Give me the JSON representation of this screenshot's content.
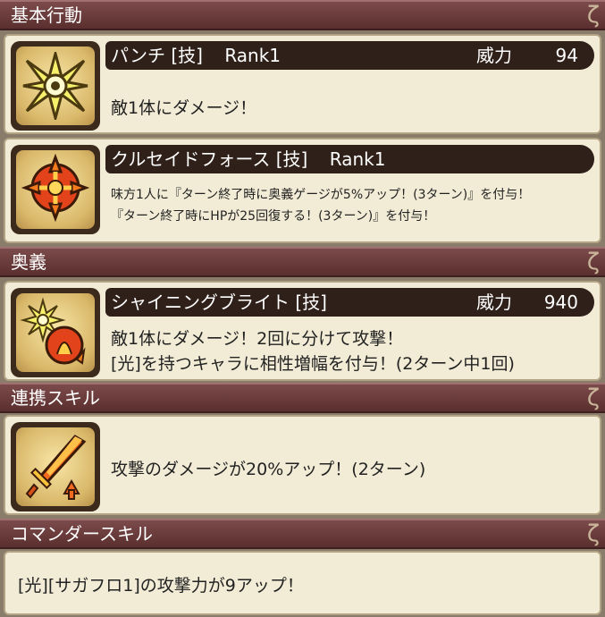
{
  "sections": {
    "basic": "基本行動",
    "ougi": "奥義",
    "link": "連携スキル",
    "commander": "コマンダースキル"
  },
  "curl_glyph": "ζ",
  "skills": {
    "punch": {
      "name": "パンチ [技]",
      "rank": "Rank1",
      "power_label": "威力",
      "power": "94",
      "desc": "敵1体にダメージ！",
      "icon": "star-burst-icon"
    },
    "crusade": {
      "name": "クルセイドフォース [技]",
      "rank": "Rank1",
      "desc1": "味方1人に『ターン終了時に奥義ゲージが5%アップ！(3ターン)』を付与！",
      "desc2": "『ターン終了時にHPが25回復する！(3ターン)』を付与！",
      "icon": "crusade-emblem-icon"
    },
    "shining": {
      "name": "シャイニングブライト [技]",
      "power_label": "威力",
      "power": "940",
      "desc1": "敵1体にダメージ！2回に分けて攻撃！",
      "desc2": "[光]を持つキャラに相性増幅を付与！(2ターン中1回)",
      "icon": "shining-bright-icon"
    },
    "link_skill": {
      "desc": "攻撃のダメージが20%アップ！(2ターン)",
      "icon": "flaming-sword-icon"
    },
    "commander_skill": {
      "desc": "[光][サガフロ1]の攻撃力が9アップ！"
    }
  },
  "colors": {
    "header": "#6b3b3b",
    "panel": "#f2ecd6",
    "title_bar": "#2f2019"
  }
}
